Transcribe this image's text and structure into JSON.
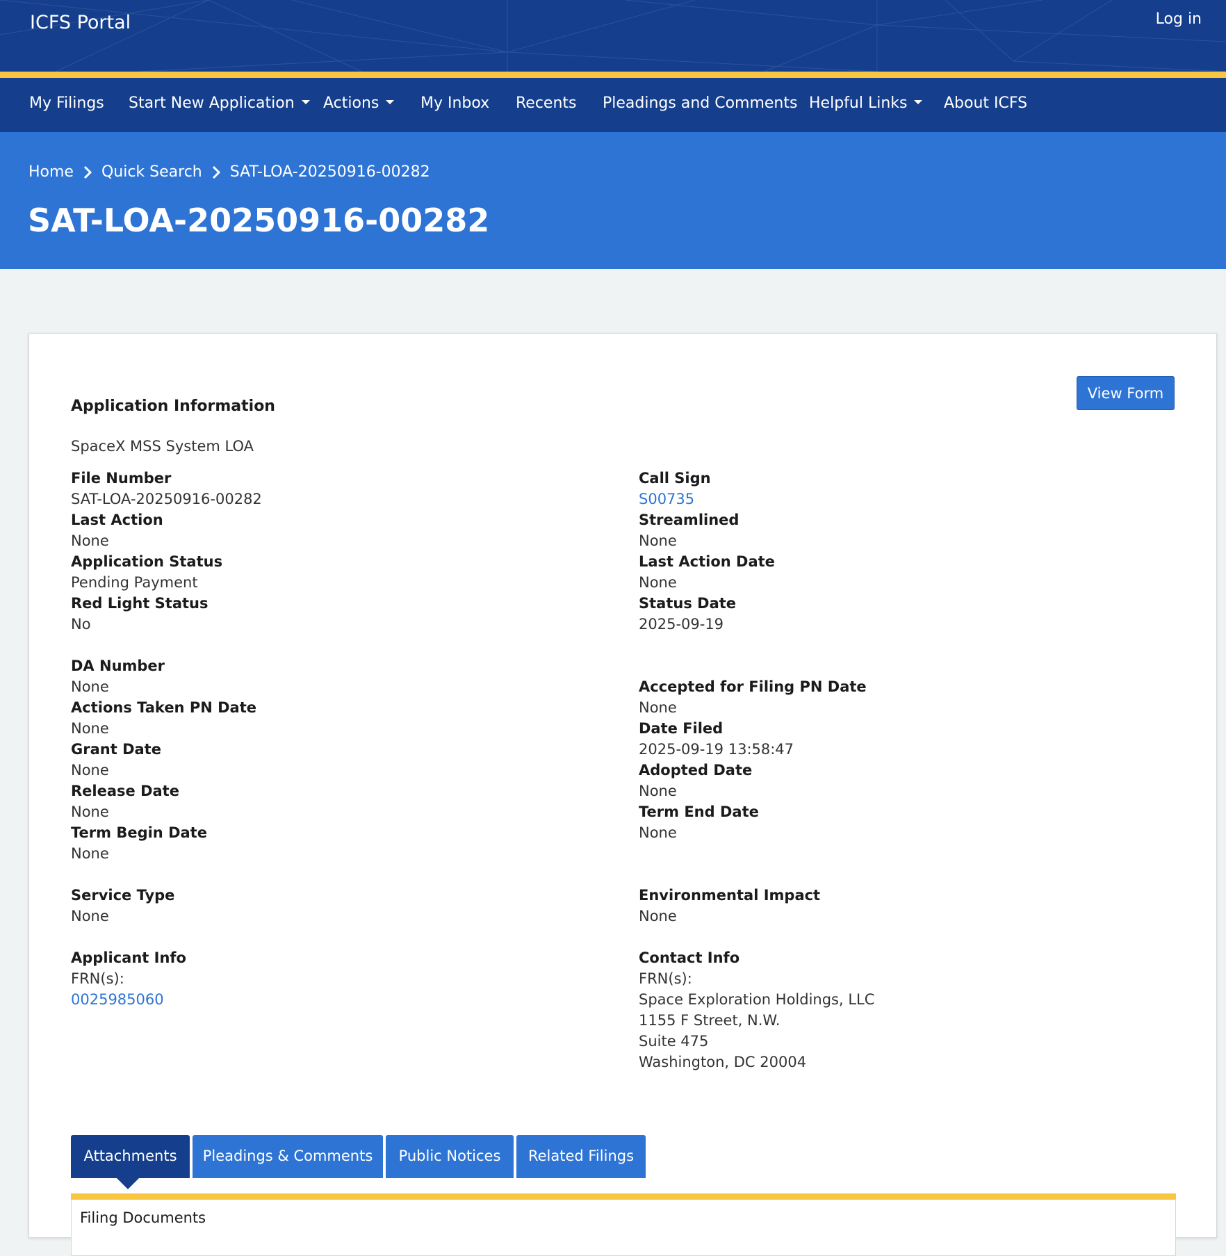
{
  "header": {
    "portal_title": "ICFS Portal",
    "login_label": "Log in"
  },
  "nav": {
    "items": [
      {
        "label": "My Filings"
      },
      {
        "label": "Start New Application"
      },
      {
        "label": "Actions"
      },
      {
        "label": "My Inbox"
      },
      {
        "label": "Recents"
      },
      {
        "label": "Pleadings and Comments"
      },
      {
        "label": "Helpful Links"
      },
      {
        "label": "About ICFS"
      }
    ]
  },
  "breadcrumb": {
    "home": "Home",
    "quick_search": "Quick Search",
    "current": "SAT-LOA-20250916-00282"
  },
  "page_title": "SAT-LOA-20250916-00282",
  "card": {
    "view_form_label": "View Form",
    "section_heading": "Application Information",
    "description": "SpaceX MSS System LOA",
    "fields": {
      "file_number": {
        "label": "File Number",
        "value": "SAT-LOA-20250916-00282"
      },
      "last_action": {
        "label": "Last Action",
        "value": "None"
      },
      "application_status": {
        "label": "Application Status",
        "value": "Pending Payment"
      },
      "red_light_status": {
        "label": "Red Light Status",
        "value": "No"
      },
      "call_sign": {
        "label": "Call Sign",
        "value": "S00735"
      },
      "streamlined": {
        "label": "Streamlined",
        "value": "None"
      },
      "last_action_date": {
        "label": "Last Action Date",
        "value": "None"
      },
      "status_date": {
        "label": "Status Date",
        "value": "2025-09-19"
      },
      "da_number": {
        "label": "DA Number",
        "value": "None"
      },
      "actions_taken_pn_date": {
        "label": "Actions Taken PN Date",
        "value": "None"
      },
      "grant_date": {
        "label": "Grant Date",
        "value": "None"
      },
      "release_date": {
        "label": "Release Date",
        "value": "None"
      },
      "term_begin_date": {
        "label": "Term Begin Date",
        "value": "None"
      },
      "accepted_for_filing_pn_date": {
        "label": "Accepted for Filing PN Date",
        "value": "None"
      },
      "date_filed": {
        "label": "Date Filed",
        "value": "2025-09-19 13:58:47"
      },
      "adopted_date": {
        "label": "Adopted Date",
        "value": "None"
      },
      "term_end_date": {
        "label": "Term End Date",
        "value": "None"
      },
      "service_type": {
        "label": "Service Type",
        "value": "None"
      },
      "environmental_impact": {
        "label": "Environmental Impact",
        "value": "None"
      }
    },
    "applicant_info": {
      "label": "Applicant Info",
      "frn_label": "FRN(s):",
      "frn": "0025985060"
    },
    "contact_info": {
      "label": "Contact Info",
      "frn_label": "FRN(s):",
      "lines": [
        "Space Exploration Holdings, LLC",
        "1155 F Street, N.W.",
        "Suite 475",
        "Washington, DC 20004"
      ]
    },
    "tabs": [
      {
        "label": "Attachments",
        "active": true
      },
      {
        "label": "Pleadings & Comments",
        "active": false
      },
      {
        "label": "Public Notices",
        "active": false
      },
      {
        "label": "Related Filings",
        "active": false
      }
    ],
    "filing_documents_title": "Filing Documents"
  },
  "colors": {
    "navy": "#153f8c",
    "blue": "#2e74d5",
    "gold": "#f9c642",
    "link": "#2e74d5"
  }
}
